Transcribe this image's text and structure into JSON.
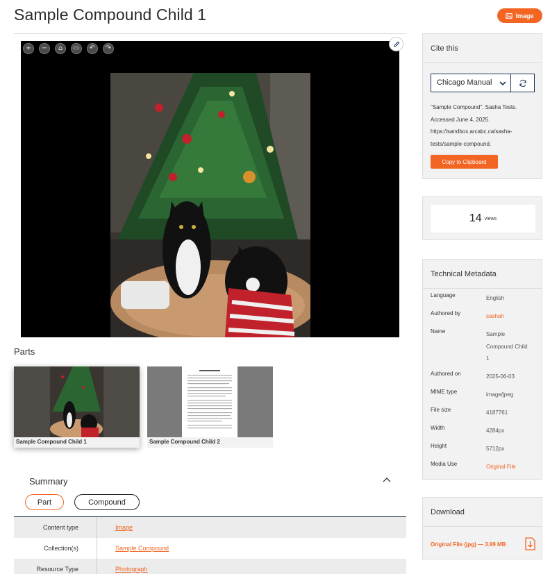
{
  "page": {
    "title": "Sample Compound Child 1"
  },
  "badge": {
    "label": "Image",
    "icon": "image-icon"
  },
  "viewer": {
    "tools": [
      "zoom-in-icon",
      "zoom-out-icon",
      "home-icon",
      "fullscreen-icon",
      "rotate-left-icon",
      "rotate-right-icon"
    ]
  },
  "parts": {
    "title": "Parts",
    "items": [
      {
        "label": "Sample Compound Child 1"
      },
      {
        "label": "Sample Compound Child 2"
      }
    ]
  },
  "summary": {
    "title": "Summary",
    "tabs": {
      "part": "Part",
      "compound": "Compound"
    },
    "rows": [
      {
        "key": "Content type",
        "value": "Image"
      },
      {
        "key": "Collection(s)",
        "value": "Sample Compound"
      },
      {
        "key": "Resource Type",
        "value": "Photograph"
      }
    ]
  },
  "cite": {
    "title": "Cite this",
    "style": "Chicago Manual",
    "text": "\"Sample Compound\". Sasha Tests. Accessed June 4, 2025. https://sandbox.arcabc.ca/sasha-tests/sample-compound.",
    "copy_label": "Copy to Clipboard"
  },
  "views": {
    "count": "14",
    "label": "views"
  },
  "metadata": {
    "title": "Technical Metadata",
    "rows": [
      {
        "key": "Language",
        "value": "English"
      },
      {
        "key": "Authored by",
        "value": "sashah"
      },
      {
        "key": "Name",
        "value": "Sample Compound Child 1"
      },
      {
        "key": "Authored on",
        "value": "2025-06-03"
      },
      {
        "key": "MIME type",
        "value": "image/jpeg"
      },
      {
        "key": "File size",
        "value": "4187761"
      },
      {
        "key": "Width",
        "value": "4284px"
      },
      {
        "key": "Height",
        "value": "5712px"
      },
      {
        "key": "Media Use",
        "value": "Original File"
      }
    ]
  },
  "download": {
    "title": "Download",
    "link": "Original File (jpg) — 3.99 MB",
    "icon": "download-icon"
  },
  "colors": {
    "accent": "#f26522",
    "navy": "#1d3557"
  }
}
